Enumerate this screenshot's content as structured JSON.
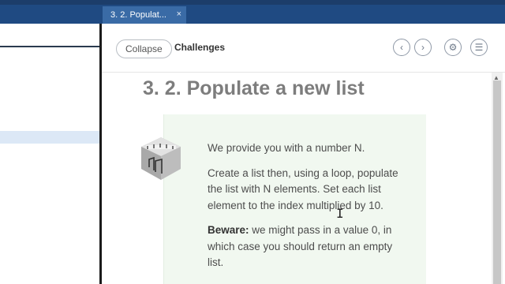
{
  "tab": {
    "title": "3. 2. Populat...",
    "close": "×"
  },
  "toolbar": {
    "collapse_label": "Collapse",
    "section_label": "Challenges",
    "prev_glyph": "‹",
    "next_glyph": "›",
    "settings_glyph": "⚙",
    "menu_glyph": "☰"
  },
  "challenge": {
    "heading": "3. 2. Populate a new list",
    "paragraph1": "We provide you with a number N.",
    "paragraph2": "Create a list then, using a loop, populate the list with N elements. Set each list element to the index multiplied by 10.",
    "beware_label": "Beware:",
    "paragraph3": " we might pass in a value 0, in which case you should return an empty list."
  },
  "colors": {
    "tabbar": "#1f4a82",
    "card_background": "#f1f8f0",
    "heading": "#7d7d7d"
  },
  "icons": [
    "chevron-left-icon",
    "chevron-right-icon",
    "gear-icon",
    "menu-icon",
    "challenge-cube-icon",
    "text-cursor-icon"
  ]
}
